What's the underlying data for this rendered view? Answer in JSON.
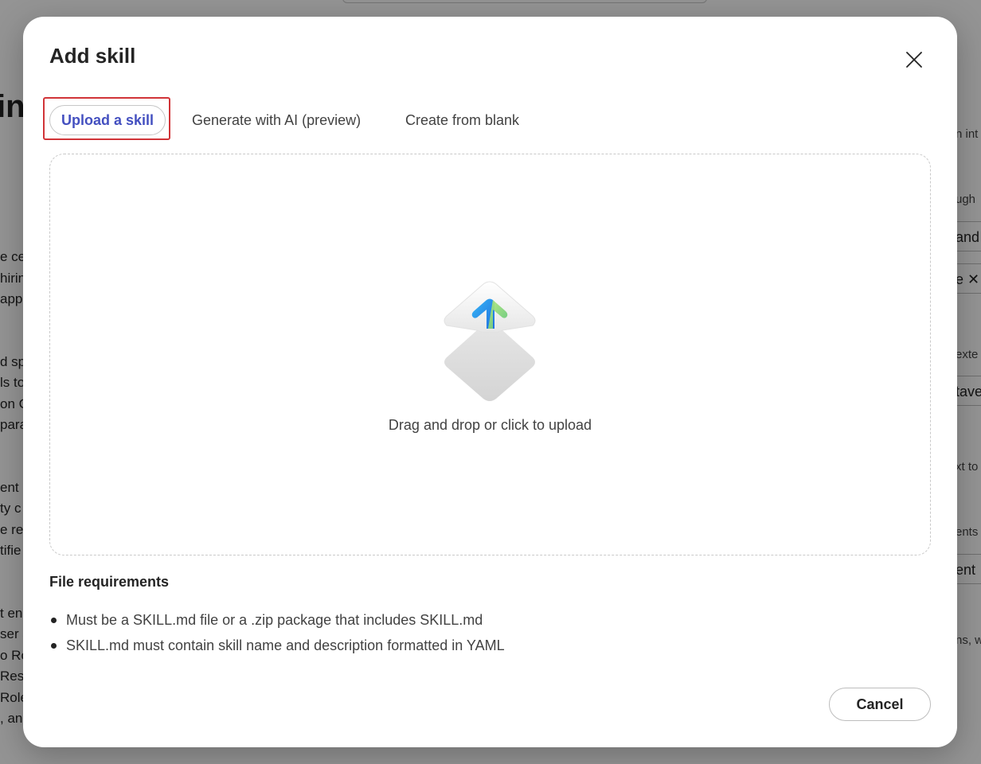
{
  "background": {
    "heading_fragment": "in",
    "left_text_lines": [
      "e ce",
      "hirin",
      "app",
      "",
      "d sp",
      "ls to",
      "on C",
      "parat",
      "",
      "ent",
      "ty c",
      "e res",
      "tifie",
      "",
      "t en",
      "ser s",
      "o Ro",
      "Res",
      "Role",
      ", an"
    ],
    "right_items": [
      {
        "text": "n int",
        "boxed": false
      },
      {
        "text": "ugh",
        "boxed": false
      },
      {
        "text": "and",
        "boxed": true
      },
      {
        "text": "e ✕",
        "boxed": true
      },
      {
        "text": "exte",
        "boxed": false
      },
      {
        "text": "tave",
        "boxed": true
      },
      {
        "text": "xt to",
        "boxed": false
      },
      {
        "text": "ents",
        "boxed": false
      },
      {
        "text": "ent",
        "boxed": true
      },
      {
        "text": "ns, w",
        "boxed": false
      }
    ]
  },
  "dialog": {
    "title": "Add skill",
    "close_icon": "close-icon",
    "tabs": [
      {
        "label": "Upload a skill",
        "selected": true
      },
      {
        "label": "Generate with AI (preview)",
        "selected": false
      },
      {
        "label": "Create from blank",
        "selected": false
      }
    ],
    "dropzone": {
      "icon": "upload-arrow-icon",
      "text": "Drag and drop or click to upload"
    },
    "requirements": {
      "title": "File requirements",
      "items": [
        "Must be a SKILL.md file or a .zip package that includes SKILL.md",
        "SKILL.md must contain skill name and description formatted in YAML"
      ]
    },
    "cancel_label": "Cancel"
  },
  "colors": {
    "accent": "#4450c0",
    "highlight_border": "#d13438",
    "overlay": "rgba(0,0,0,0.42)"
  }
}
